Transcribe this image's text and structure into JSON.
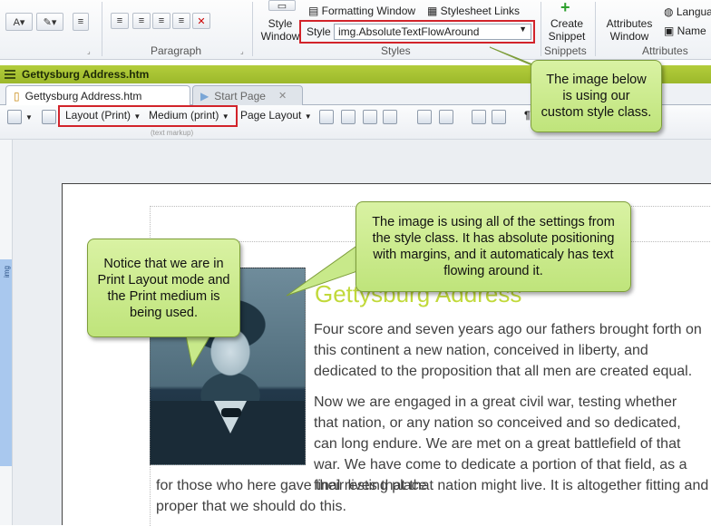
{
  "ribbon": {
    "style_window": "Style\nWindow",
    "formatting_window": "Formatting Window",
    "stylesheet_links": "Stylesheet Links",
    "style_label": "Style",
    "style_value": "img.AbsoluteTextFlowAround",
    "create_snippet": "Create\nSnippet",
    "attributes_window": "Attributes\nWindow",
    "language": "Langua",
    "name": "Name",
    "groups": {
      "paragraph": "Paragraph",
      "styles": "Styles",
      "snippets": "Snippets",
      "attributes": "Attributes"
    }
  },
  "docbar": {
    "title": "Gettysburg Address.htm"
  },
  "tabs": [
    {
      "label": "Gettysburg Address.htm",
      "active": true
    },
    {
      "label": "Start Page",
      "active": false
    }
  ],
  "editor_toolbar": {
    "layout": "Layout (Print)",
    "medium": "Medium (print)",
    "page_layout": "Page Layout",
    "hint": "(text markup)"
  },
  "editor": {
    "side_tag": "img",
    "doc_title": "Gettysburg Address",
    "para1": "Four score and seven years ago our fathers brought forth on this continent a new nation, conceived in liberty, and dedicated to the proposition that all men are created equal.",
    "para2": "Now we are engaged in a great civil war, testing whether that nation, or any nation so conceived and so dedicated, can long endure. We are met on a great battlefield of that war. We have come to dedicate a portion of that field, as a final resting place",
    "para2_cont": "for those who here gave their lives that that nation might live. It is altogether fitting and proper that we should do this."
  },
  "callouts": {
    "style_class": "The image below is using our custom style class.",
    "settings": "The image is using all of the settings from the style class. It has absolute positioning with margins, and it automaticaly has text flowing around it.",
    "print_mode": "Notice that we are in Print Layout mode and the Print medium is being used."
  },
  "colors": {
    "accent_green": "#a8c432",
    "callout_fill": "#c8e98a",
    "highlight_red": "#d2232a",
    "title_green": "#c1d93a"
  }
}
